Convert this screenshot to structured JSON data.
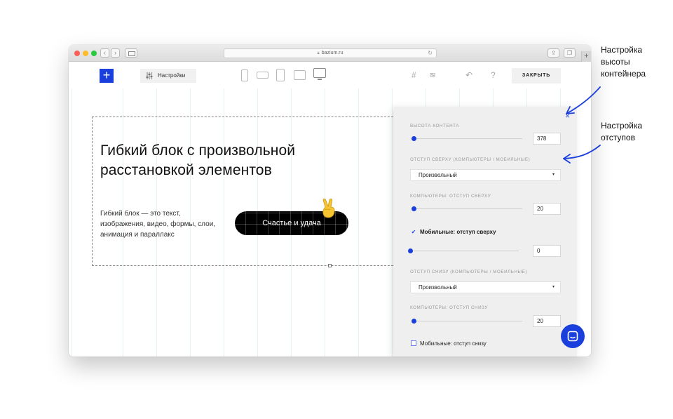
{
  "browser": {
    "url": "bazium.ru",
    "nav_back": "‹",
    "nav_forward": "›",
    "new_tab": "+"
  },
  "editor": {
    "add_button": "+",
    "settings_label": "Настройки",
    "grid_icon": "#",
    "layers_icon": "≋",
    "undo_icon": "↶",
    "help_icon": "?",
    "close_label": "ЗАКРЫТЬ"
  },
  "block": {
    "heading_line1": "Гибкий блок с произвольной",
    "heading_line2": "расстановкой элементов",
    "subtext_line1": "Гибкий блок — это текст,",
    "subtext_line2": "изображения, видео, формы, слои,",
    "subtext_line3": "анимация и параллакс",
    "cta_label": "Счастье и удача"
  },
  "panel": {
    "close_icon": "×",
    "content_height_label": "ВЫСОТА КОНТЕНТА",
    "content_height_value": "378",
    "top_padding_label": "ОТСТУП СВЕРХУ (КОМПЬЮТЕРЫ / МОБИЛЬНЫЕ)",
    "top_padding_select": "Произвольный",
    "desktop_top_label": "КОМПЬЮТЕРЫ: ОТСТУП СВЕРХУ",
    "desktop_top_value": "20",
    "mobile_top_checkbox": "Мобильные: отступ сверху",
    "mobile_top_checked": true,
    "mobile_top_value": "0",
    "bottom_padding_label": "ОТСТУП СНИЗУ (КОМПЬЮТЕРЫ / МОБИЛЬНЫЕ)",
    "bottom_padding_select": "Произвольный",
    "desktop_bottom_label": "КОМПЬЮТЕРЫ: ОТСТУП СНИЗУ",
    "desktop_bottom_value": "20",
    "mobile_bottom_checkbox": "Мобильные: отступ снизу",
    "mobile_bottom_checked": false,
    "select_arrow": "▾"
  },
  "annotations": {
    "height_line1": "Настройка",
    "height_line2": "высоты",
    "height_line3": "контейнера",
    "padding_line1": "Настройка",
    "padding_line2": "отступов"
  },
  "colors": {
    "accent": "#1a3fdc",
    "panel_bg": "#efefef",
    "button_black": "#000000"
  }
}
